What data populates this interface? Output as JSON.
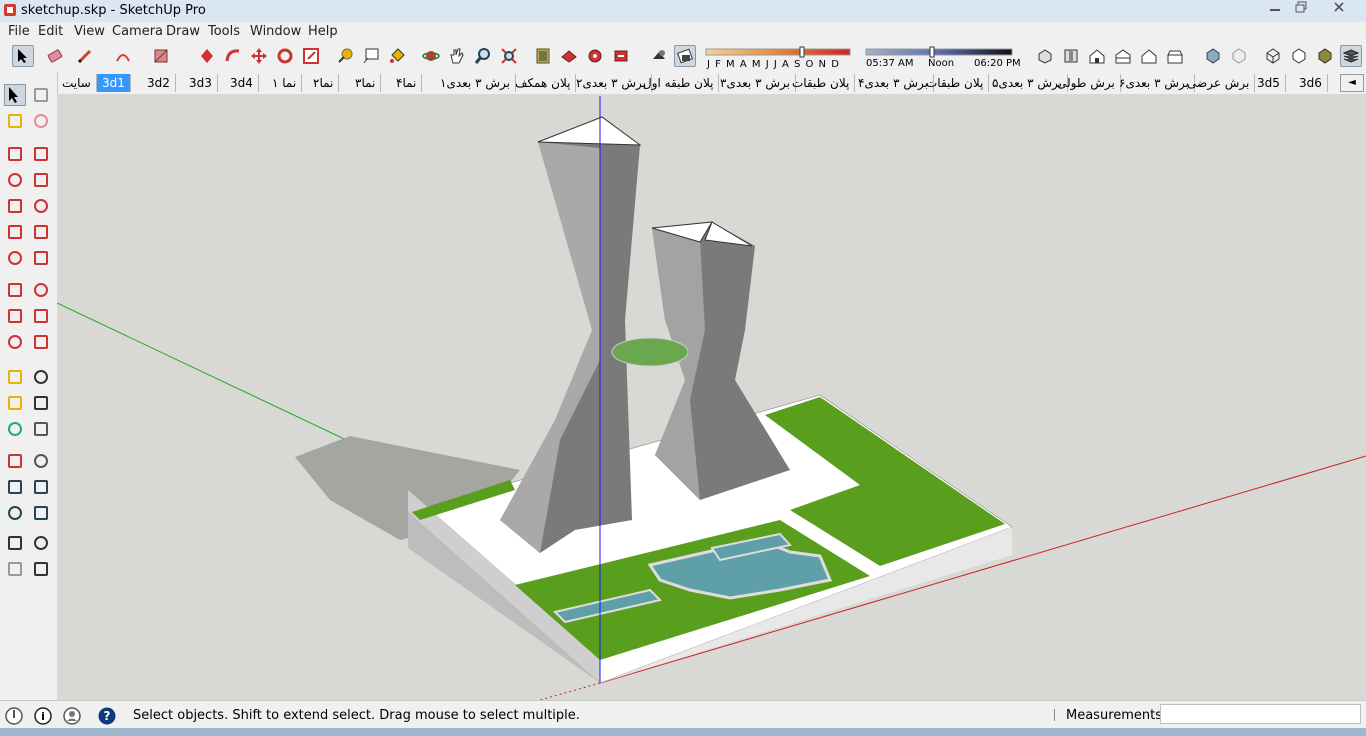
{
  "window": {
    "title": "sketchup.skp - SketchUp Pro",
    "minimize_icon": "minimize-icon",
    "restore_icon": "restore-icon",
    "close_icon": "close-icon"
  },
  "menu": [
    "File",
    "Edit",
    "View",
    "Camera",
    "Draw",
    "Tools",
    "Window",
    "Help"
  ],
  "shadows": {
    "months": "J F M A M J J A S O N D",
    "time_start": "05:37 AM",
    "time_mid": "Noon",
    "time_end": "06:20 PM"
  },
  "scene_tabs": [
    {
      "label": "سایت",
      "active": false
    },
    {
      "label": "3d1",
      "active": true
    },
    {
      "label": "3d2",
      "active": false
    },
    {
      "label": "3d3",
      "active": false
    },
    {
      "label": "3d4",
      "active": false
    },
    {
      "label": "نما ۱",
      "active": false
    },
    {
      "label": "نما۲",
      "active": false
    },
    {
      "label": "نما۳",
      "active": false
    },
    {
      "label": "نما۴",
      "active": false
    },
    {
      "label": "برش ۳ بعدی۱",
      "active": false
    },
    {
      "label": "پلان همکف",
      "active": false
    },
    {
      "label": "برش ۳ بعدی۲",
      "active": false
    },
    {
      "label": "پلان طبقه اول",
      "active": false
    },
    {
      "label": "برش ۳ بعدی۳",
      "active": false
    },
    {
      "label": "پلان طبقات",
      "active": false
    },
    {
      "label": "برش ۳ بعدی۴",
      "active": false
    },
    {
      "label": "پلان طبقات",
      "active": false
    },
    {
      "label": "برش ۳ بعدی۵",
      "active": false
    },
    {
      "label": "برش طولی",
      "active": false
    },
    {
      "label": "برش ۳ بعدی۶",
      "active": false
    },
    {
      "label": "برش عرضی",
      "active": false
    },
    {
      "label": "3d5",
      "active": false
    },
    {
      "label": "3d6",
      "active": false
    }
  ],
  "status": {
    "message": "Select objects. Shift to extend select. Drag mouse to select multiple.",
    "measurements_label": "Measurements",
    "measurements_value": ""
  },
  "colors": {
    "grass": "#5a9e1e",
    "axis_red": "#cc2222",
    "axis_green": "#22aa22",
    "axis_blue": "#1a1aee",
    "selected_tab": "#3399ff"
  }
}
